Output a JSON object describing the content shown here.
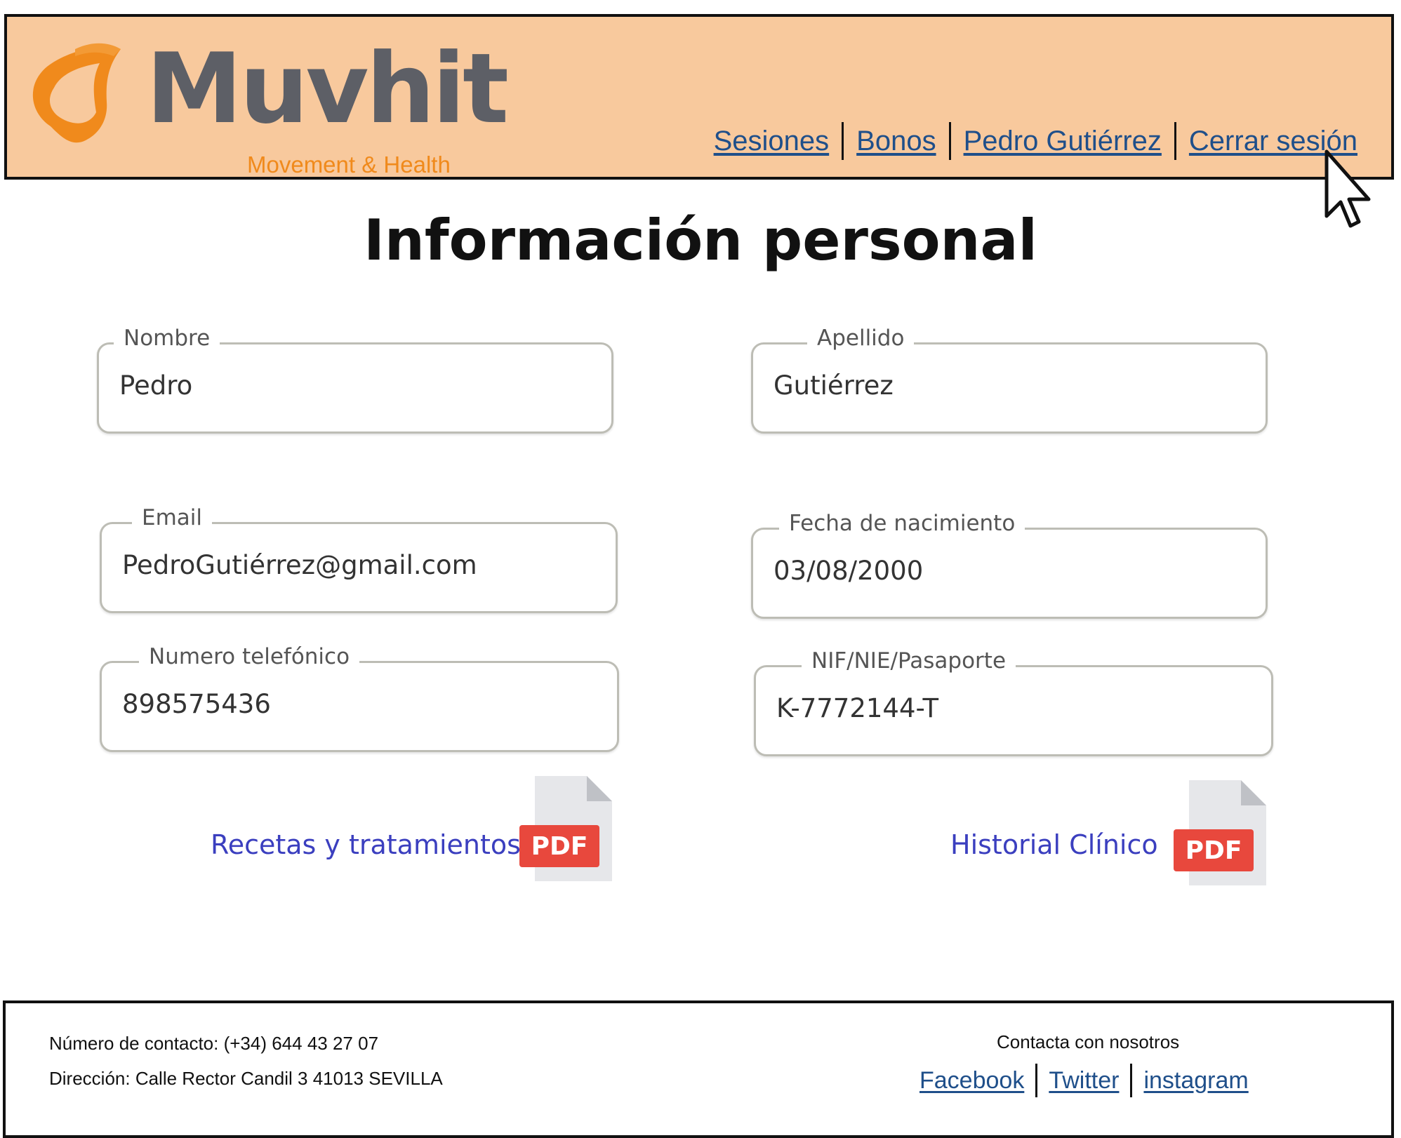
{
  "header": {
    "logo_name": "Muvhit",
    "logo_tagline": "Movement & Health",
    "nav": [
      "Sesiones",
      "Bonos",
      "Pedro Gutiérrez",
      "Cerrar sesión"
    ]
  },
  "page_title": "Información personal",
  "fields": {
    "nombre": {
      "label": "Nombre",
      "value": "Pedro"
    },
    "apellido": {
      "label": "Apellido",
      "value": "Gutiérrez"
    },
    "email": {
      "label": "Email",
      "value": "PedroGutiérrez@gmail.com"
    },
    "fecha": {
      "label": "Fecha de nacimiento",
      "value": "03/08/2000"
    },
    "telefono": {
      "label": "Numero telefónico",
      "value": "898575436"
    },
    "nif": {
      "label": "NIF/NIE/Pasaporte",
      "value": "K-7772144-T"
    }
  },
  "documents": {
    "recetas": {
      "label": "Recetas y tratamientos",
      "badge": "PDF"
    },
    "historial": {
      "label": "Historial Clínico",
      "badge": "PDF"
    }
  },
  "footer": {
    "phone": "Número de contacto:  (+34) 644 43 27 07",
    "address": "Dirección: Calle Rector Candil 3 41013 SEVILLA",
    "contact_heading": "Contacta con nosotros",
    "social": [
      "Facebook",
      "Twitter",
      "instagram"
    ]
  },
  "colors": {
    "header_bg": "#f8c99d",
    "brand_orange": "#f08a1c",
    "brand_gray": "#5d5f66",
    "link": "#1f4f8a",
    "pdf_red": "#e8483d"
  },
  "icons": [
    "muvhit-logo-icon",
    "cursor-icon",
    "pdf-file-icon"
  ]
}
